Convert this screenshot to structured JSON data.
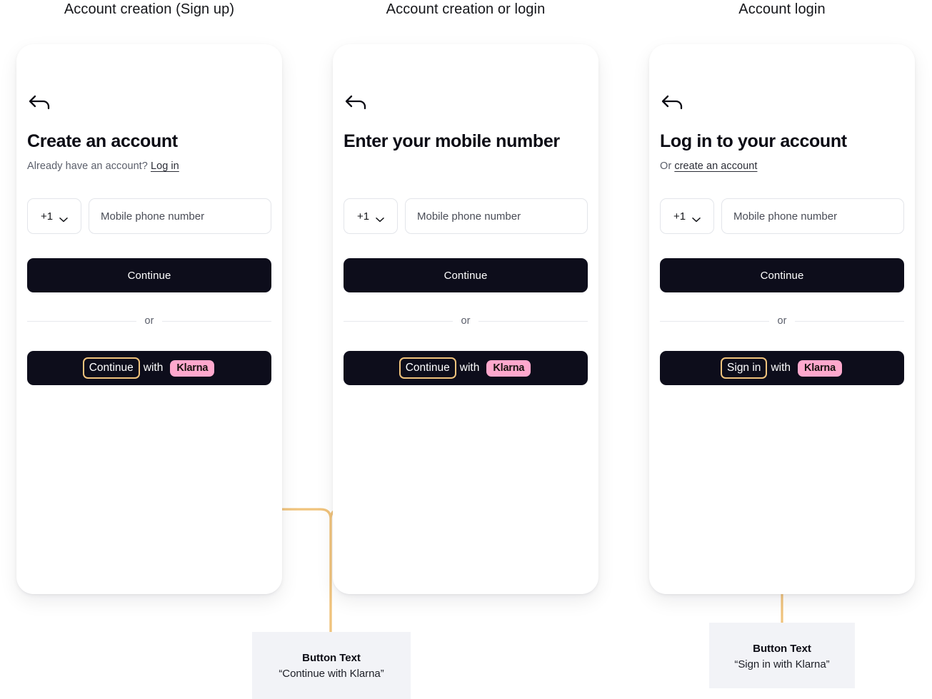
{
  "columns": [
    {
      "header": "Account creation (Sign up)"
    },
    {
      "header": "Account creation or login"
    },
    {
      "header": "Account login"
    }
  ],
  "theme": {
    "accent_connector": "#f0c37c",
    "highlight_border": "#f0c37c",
    "klarna_pink": "#ffa8cd",
    "button_dark": "#0d0d1b",
    "callout_bg": "#f2f3f7",
    "page_bg": "#ffffff"
  },
  "screens": [
    {
      "back_icon": "arrow-left-icon",
      "title": "Create an account",
      "subtitle_prefix": "Already have an account?",
      "subtitle_link": "Log in",
      "country_code": "+1",
      "phone_placeholder": "Mobile phone number",
      "primary_button": "Continue",
      "divider": "or",
      "klarna_verb": "Continue",
      "klarna_with": "with",
      "klarna_brand": "Klarna"
    },
    {
      "back_icon": "arrow-left-icon",
      "title": "Enter your mobile number",
      "subtitle_prefix": "",
      "subtitle_link": "",
      "country_code": "+1",
      "phone_placeholder": "Mobile phone number",
      "primary_button": "Continue",
      "divider": "or",
      "klarna_verb": "Continue",
      "klarna_with": "with",
      "klarna_brand": "Klarna"
    },
    {
      "back_icon": "arrow-left-icon",
      "title": "Log in to your account",
      "subtitle_prefix": "Or",
      "subtitle_link": "create an account",
      "country_code": "+1",
      "phone_placeholder": "Mobile phone number",
      "primary_button": "Continue",
      "divider": "or",
      "klarna_verb": "Sign in",
      "klarna_with": "with",
      "klarna_brand": "Klarna"
    }
  ],
  "callouts": [
    {
      "title": "Button Text",
      "value": "“Continue with Klarna”"
    },
    {
      "title": "Button Text",
      "value": "“Sign in with Klarna”"
    }
  ]
}
